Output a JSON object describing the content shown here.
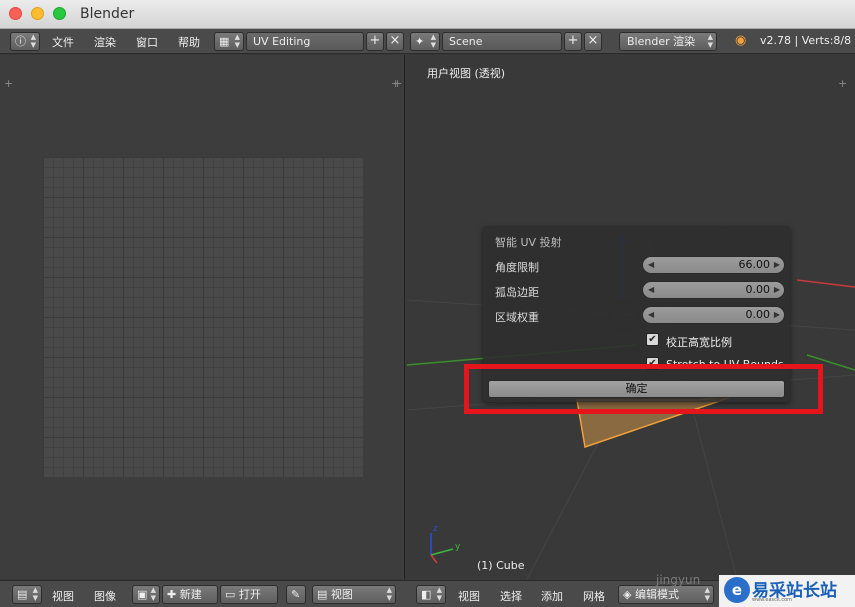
{
  "window": {
    "title": "Blender"
  },
  "info_header": {
    "menus": [
      "文件",
      "渲染",
      "窗口",
      "帮助"
    ],
    "screen_layout": "UV Editing",
    "scene": "Scene",
    "render_engine": "Blender 渲染",
    "version_stats": "v2.78 | Verts:8/8 |"
  },
  "viewport": {
    "view_label": "用户视图 (透视)",
    "object_label": "(1) Cube"
  },
  "smart_uv_panel": {
    "title": "智能 UV 投射",
    "fields": [
      {
        "label": "角度限制",
        "value": "66.00"
      },
      {
        "label": "孤岛边距",
        "value": "0.00"
      },
      {
        "label": "区域权重",
        "value": "0.00"
      }
    ],
    "checkboxes": [
      {
        "label": "校正高宽比例",
        "checked": true
      },
      {
        "label": "Stretch to UV Bounds",
        "checked": true
      }
    ],
    "ok_label": "确定"
  },
  "uv_footer": {
    "menus": [
      "视图",
      "图像"
    ],
    "new_label": "新建",
    "open_label": "打开",
    "view_dropdown": "视图"
  },
  "view3d_footer": {
    "menus": [
      "视图",
      "选择",
      "添加",
      "网格"
    ],
    "mode": "编辑模式"
  },
  "watermark": {
    "faint_text": "jingyun",
    "site": "易采站长站",
    "url": "www.easck.com"
  },
  "colors": {
    "highlight": "#e6141b",
    "accent": "#f2a13a"
  }
}
